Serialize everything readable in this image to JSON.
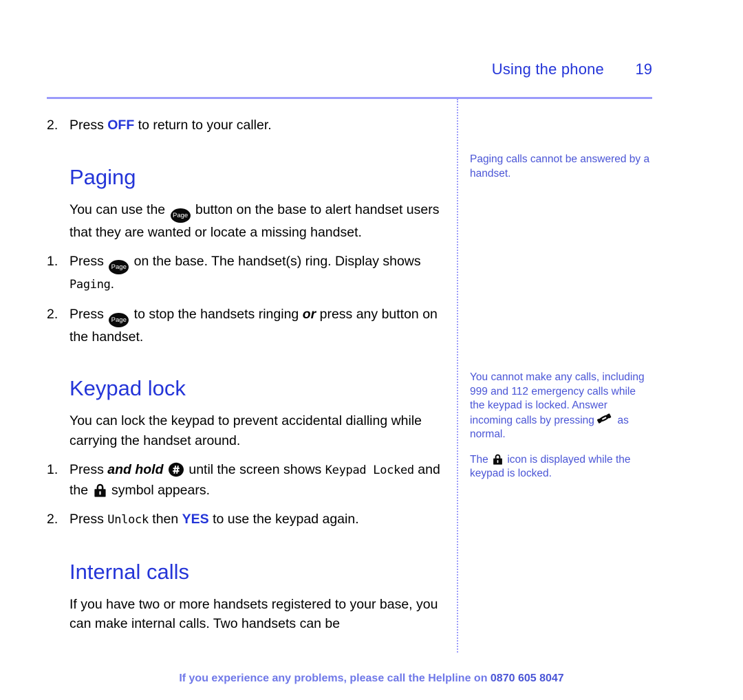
{
  "header": {
    "title": "Using the phone",
    "page_number": "19"
  },
  "main": {
    "intro_step": {
      "num": "2.",
      "pre": "Press ",
      "keyword": "OFF",
      "post": " to return to your caller."
    },
    "paging": {
      "heading": "Paging",
      "body_a": "You can use the ",
      "body_b": " button on the base to alert handset users that they are wanted or locate a missing handset.",
      "steps": [
        {
          "num": "1.",
          "a": "Press ",
          "b": " on the base. The handset(s) ring. Display shows ",
          "lcd": "Paging",
          "c": "."
        },
        {
          "num": "2.",
          "a": "Press ",
          "b": " to stop the handsets ringing ",
          "em": "or",
          "c": " press any button on the handset."
        }
      ]
    },
    "keypad_lock": {
      "heading": "Keypad lock",
      "body": "You can lock the keypad to prevent accidental dialling while carrying the handset around.",
      "steps": [
        {
          "num": "1.",
          "a": "Press ",
          "em": "and hold",
          "b": " until the screen shows ",
          "lcd1": "Keypad Locked",
          "c": " and the ",
          "d": " symbol appears."
        },
        {
          "num": "2.",
          "a": "Press ",
          "lcd1": "Unlock",
          "b": " then ",
          "keyword": "YES",
          "c": " to use the keypad again."
        }
      ]
    },
    "internal_calls": {
      "heading": "Internal calls",
      "body": "If you have two or more handsets registered to your base, you can make internal calls. Two handsets can be"
    }
  },
  "sidebar": {
    "notes": [
      {
        "text": "Paging calls cannot be answered by a handset."
      },
      {
        "a": "You cannot make any calls, including 999 and 112 emergency calls while the keypad is locked. Answer incoming calls by pressing ",
        "b": " as normal."
      },
      {
        "a": "The ",
        "b": " icon is displayed while the keypad is locked."
      }
    ]
  },
  "footer": {
    "text": "If you experience any problems, please call the Helpline on ",
    "phone": "0870 605 8047"
  },
  "icons": {
    "page_button_label": "Page",
    "hash_button": "hash-button-icon",
    "padlock": "padlock-icon",
    "handset": "handset-icon"
  },
  "colors": {
    "heading_blue": "#2435d8",
    "rule_periwinkle": "#9b9bfb",
    "sidebar_blue": "#4a55d6",
    "footer_blue": "#6f78e8"
  }
}
